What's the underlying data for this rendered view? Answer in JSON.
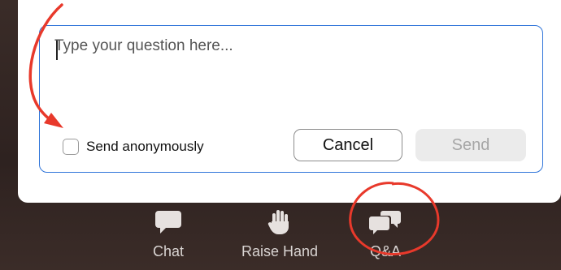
{
  "question_form": {
    "placeholder": "Type your question here...",
    "anonymous_label": "Send anonymously",
    "anonymous_checked": false,
    "cancel_label": "Cancel",
    "send_label": "Send"
  },
  "toolbar": {
    "items": [
      {
        "label": "Chat",
        "icon": "chat-bubble-icon"
      },
      {
        "label": "Raise Hand",
        "icon": "raise-hand-icon"
      },
      {
        "label": "Q&A",
        "icon": "qa-bubbles-icon"
      }
    ]
  },
  "colors": {
    "input_border": "#2f74d9",
    "annotation": "#e8392b",
    "toolbar_bg": "#2e2220",
    "toolbar_icon": "#e6e1df"
  }
}
